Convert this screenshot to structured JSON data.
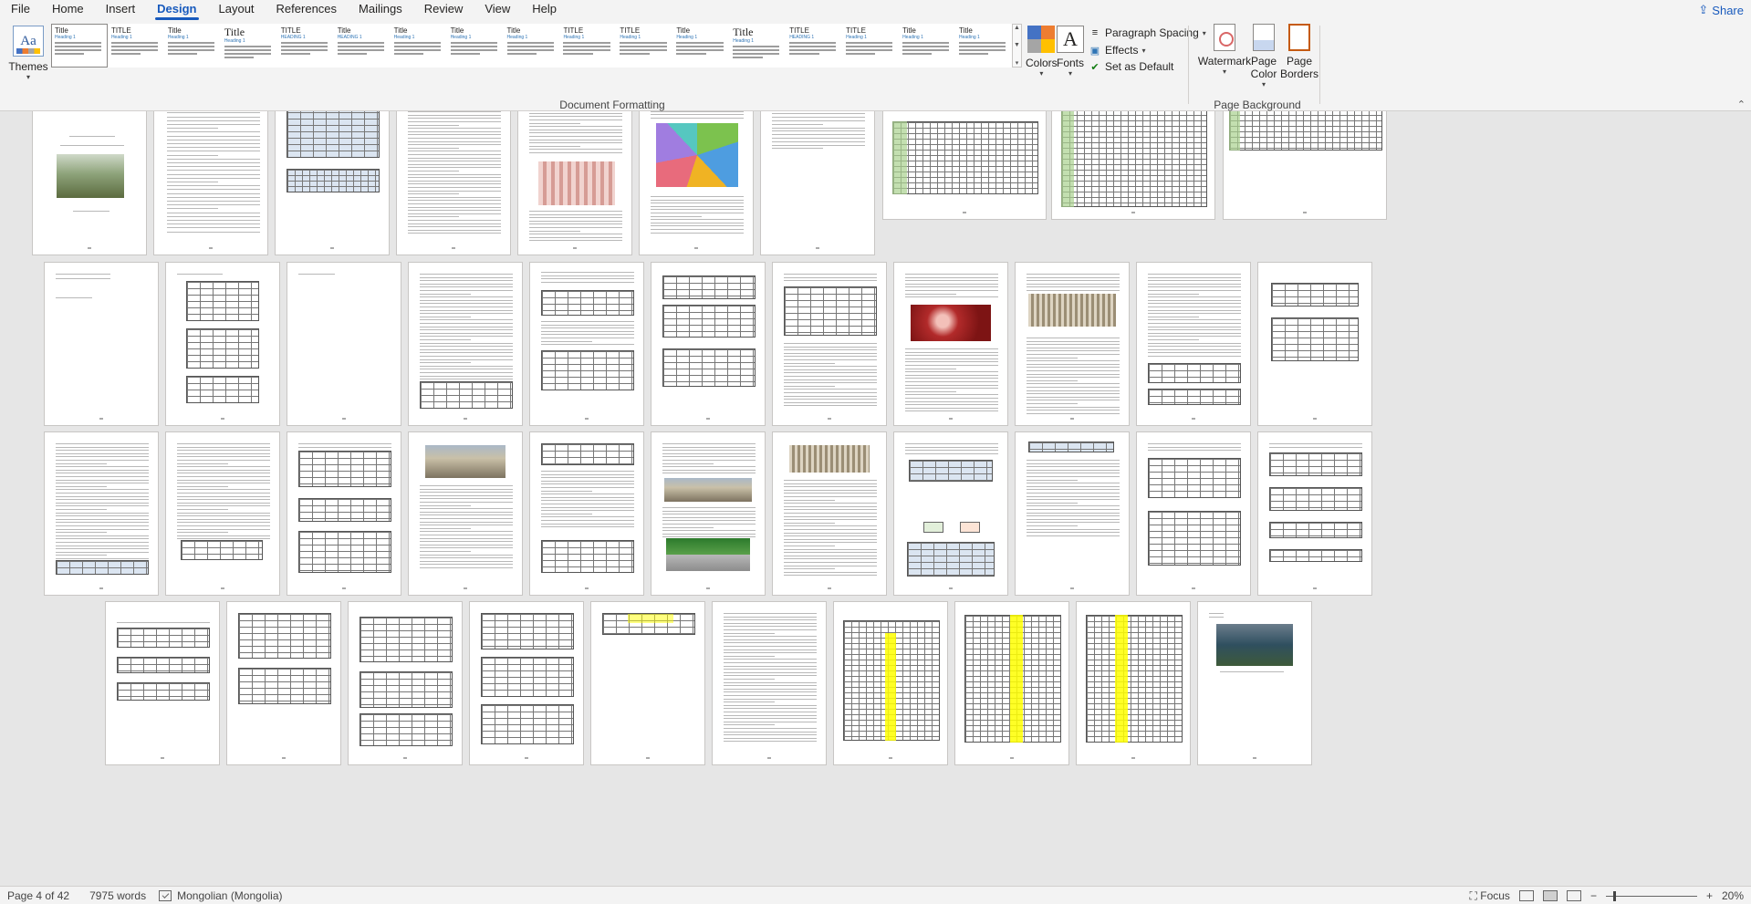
{
  "menu": {
    "tabs": [
      "File",
      "Home",
      "Insert",
      "Design",
      "Layout",
      "References",
      "Mailings",
      "Review",
      "View",
      "Help"
    ],
    "active_tab": "Design",
    "share_label": "Share"
  },
  "ribbon": {
    "themes_label": "Themes",
    "style_thumbnails": [
      {
        "title": "Title",
        "heading": "Heading 1",
        "big": false
      },
      {
        "title": "TITLE",
        "heading": "Heading 1",
        "big": false
      },
      {
        "title": "Title",
        "heading": "Heading 1",
        "big": false
      },
      {
        "title": "Title",
        "heading": "Heading 1",
        "big": true
      },
      {
        "title": "TITLE",
        "heading": "HEADING 1",
        "big": false
      },
      {
        "title": "Title",
        "heading": "HEADING 1",
        "big": false
      },
      {
        "title": "Title",
        "heading": "Heading 1",
        "big": false
      },
      {
        "title": "Title",
        "heading": "Heading 1",
        "big": false
      },
      {
        "title": "Title",
        "heading": "Heading 1",
        "big": false
      },
      {
        "title": "TITLE",
        "heading": "Heading 1",
        "big": false
      },
      {
        "title": "TITLE",
        "heading": "Heading 1",
        "big": false
      },
      {
        "title": "Title",
        "heading": "Heading 1",
        "big": false
      },
      {
        "title": "Title",
        "heading": "Heading 1",
        "big": true
      },
      {
        "title": "TITLE",
        "heading": "HEADING 1",
        "big": false
      },
      {
        "title": "TITLE",
        "heading": "Heading 1",
        "big": false
      },
      {
        "title": "Title",
        "heading": "Heading 1",
        "big": false
      },
      {
        "title": "Title",
        "heading": "Heading 1",
        "big": false
      }
    ],
    "colors_label": "Colors",
    "fonts_label": "Fonts",
    "fonts_glyph": "A",
    "paragraph_spacing_label": "Paragraph Spacing",
    "effects_label": "Effects",
    "set_default_label": "Set as Default",
    "document_formatting_label": "Document Formatting",
    "watermark_label": "Watermark",
    "page_color_label": "Page Color",
    "page_borders_label": "Page Borders",
    "page_background_label": "Page Background",
    "theme_colors": [
      "#4472c4",
      "#ed7d31",
      "#a5a5a5",
      "#ffc000"
    ]
  },
  "status": {
    "page_info": "Page 4 of 42",
    "word_count": "7975 words",
    "language": "Mongolian (Mongolia)",
    "focus_label": "Focus",
    "zoom_level": "20%",
    "zoom_minus": "−",
    "zoom_plus": "+"
  }
}
